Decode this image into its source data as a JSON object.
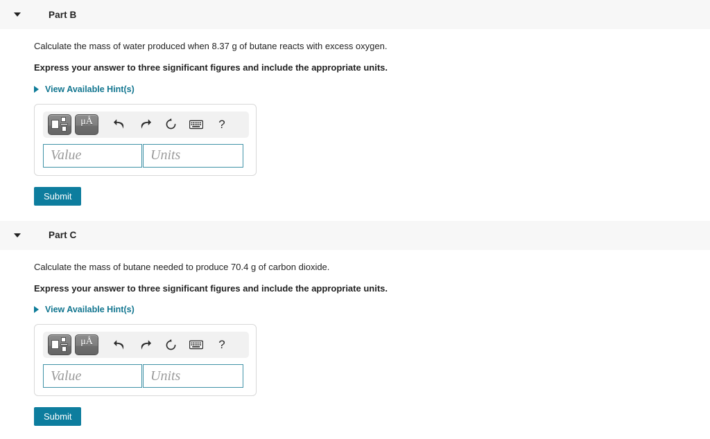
{
  "colors": {
    "accent_teal": "#11758f",
    "submit_bg": "#0d7d9e",
    "header_band": "#f7f7f7",
    "input_border": "#3f91a6",
    "text": "#222222",
    "placeholder": "#9a9a9a"
  },
  "toolbar": {
    "template_button_label": "",
    "units_button_label": "μÅ",
    "help_label": "?",
    "icons": {
      "template": "math-template-icon",
      "units": "units-micro-angstrom-icon",
      "undo": "undo-icon",
      "redo": "redo-icon",
      "reset": "reset-icon",
      "keyboard": "keyboard-icon",
      "help": "help-icon"
    }
  },
  "answer_form": {
    "value_placeholder": "Value",
    "units_placeholder": "Units",
    "value_current": "",
    "units_current": "",
    "submit_label": "Submit"
  },
  "hints": {
    "label": "View Available Hint(s)"
  },
  "parts": [
    {
      "id": "part-b",
      "title": "Part B",
      "expanded": true,
      "question": "Calculate the mass of water produced when 8.37 g of butane reacts with excess oxygen.",
      "instruction": "Express your answer to three significant figures and include the appropriate units."
    },
    {
      "id": "part-c",
      "title": "Part C",
      "expanded": true,
      "question": "Calculate the mass of butane needed to produce 70.4 g of carbon dioxide.",
      "instruction": "Express your answer to three significant figures and include the appropriate units."
    }
  ]
}
